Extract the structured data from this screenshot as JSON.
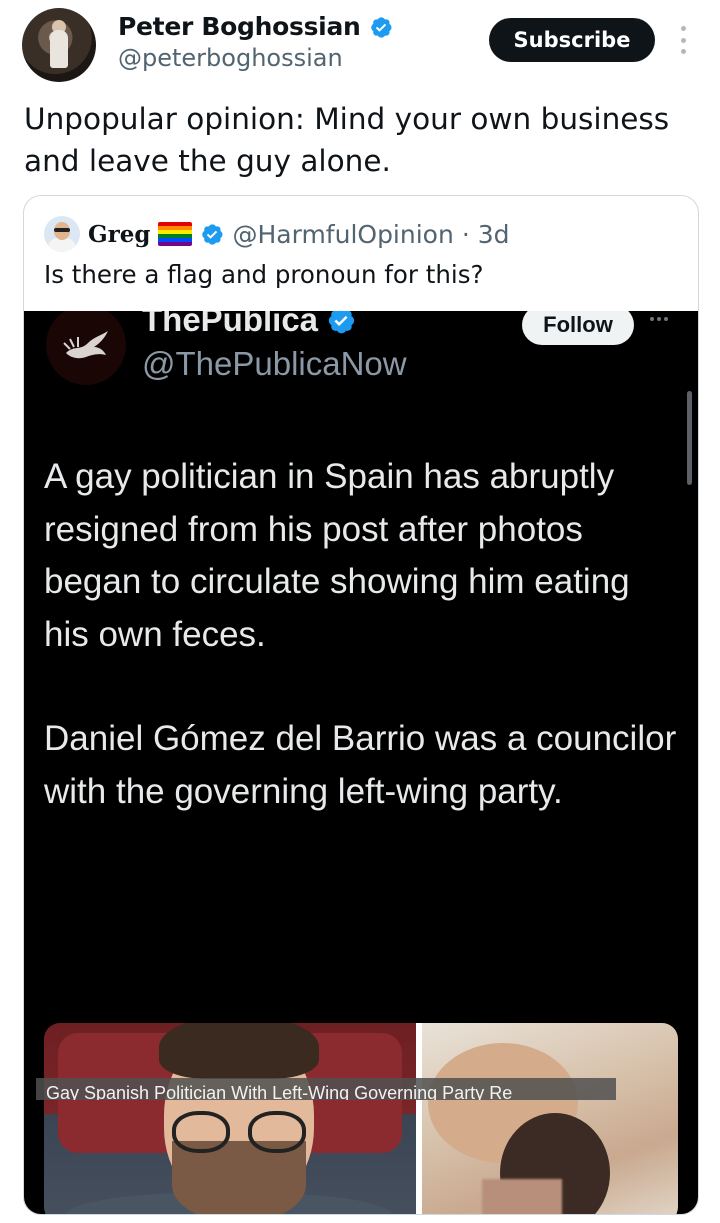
{
  "author": {
    "name": "Peter Boghossian",
    "handle": "@peterboghossian",
    "subscribe_label": "Subscribe"
  },
  "tweet": {
    "text": "Unpopular opinion: Mind your own business and leave the guy alone."
  },
  "quoted": {
    "name": "Greg",
    "handle": "@HarmfulOpinion",
    "time": "· 3d",
    "text": "Is there a flag and pronoun for this?"
  },
  "embedded": {
    "name": "ThePublica",
    "handle": "@ThePublicaNow",
    "follow_label": "Follow",
    "paragraph1": "A gay politician in Spain has abruptly resigned from his post after photos began to circulate showing him eating his own feces.",
    "paragraph2": "Daniel Gómez del Barrio was a councilor with the governing left-wing party.",
    "caption": "Gay Spanish Politician With Left-Wing Governing Party Re"
  },
  "icons": {
    "verified": "verified-badge-icon",
    "more": "more-vertical-icon",
    "rainbow": "rainbow-flag-icon"
  },
  "colors": {
    "verified_blue": "#1d9bf0",
    "subscribe_bg": "#0f1419",
    "muted": "#536471"
  }
}
